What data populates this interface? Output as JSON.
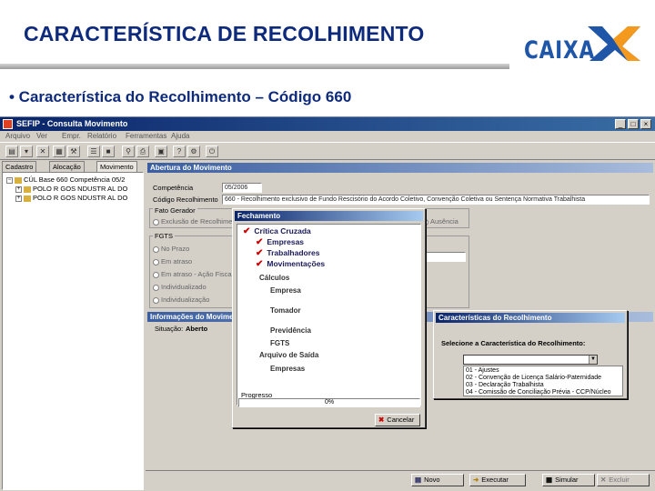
{
  "slide": {
    "title": "CARACTERÍSTICA DE RECOLHIMENTO",
    "bullet": "• Característica do Recolhimento – Código 660",
    "logo_text": "CAIXA",
    "brand_blue": "#1f56a8",
    "brand_orange": "#f39a1e"
  },
  "window": {
    "title": "SEFIP - Consulta Movimento",
    "menu": [
      "Arquivo",
      "Ver",
      "Empr.",
      "Relatório",
      "Ferramentas",
      "Ajuda"
    ],
    "controls": [
      "_",
      "□",
      "×"
    ]
  },
  "left_panel": {
    "tabs": [
      "Cadastro",
      "Alocação",
      "Movimento"
    ],
    "tree": [
      {
        "toggle": "−",
        "label": "CÚL Base 660 Competência 05/2"
      },
      {
        "toggle": "+",
        "label": "POLO R GOS NDUSTR AL DO"
      },
      {
        "toggle": "+",
        "label": "POLO R GOS NDUSTR AL DO"
      }
    ]
  },
  "main": {
    "section1": "Abertura do Movimento",
    "competencia_label": "Competência",
    "competencia_value": "05/2006",
    "codigo_label": "Código Recolhimento",
    "codigo_value": "660 - Recolhimento exclusivo de Fundo Rescisório do Acordo Coletivo, Convenção Coletiva ou Sentença Normativa Trabalhista",
    "fato_gerador_label": "Fato Gerador",
    "fato_gerador_option": "Exclusão de Recolhimento",
    "fato_gerador_option2": "Ausência",
    "fgts_label": "FGTS",
    "fgts_options": [
      "No Prazo",
      "Em atraso",
      "Em atraso - Ação Fiscal",
      "Individualizado",
      "Individualização"
    ],
    "section2": "Informações do Movimento",
    "situacao_label": "Situação:",
    "situacao_value": "Aberto"
  },
  "fechamento": {
    "title": "Fechamento",
    "checked": [
      "Crítica Cruzada",
      "Empresas",
      "Trabalhadores",
      "Movimentações"
    ],
    "calculos_label": "Cálculos",
    "calculos_items": [
      "Empresa",
      "Tomador",
      "Previdência",
      "FGTS"
    ],
    "arquivo_label": "Arquivo de Saída",
    "arquivo_items": [
      "Empresas"
    ],
    "progress_label": "Progresso",
    "progress_value": "0%",
    "progress_fraction": 0,
    "cancel_label": "Cancelar"
  },
  "caracteristicas": {
    "title": "Características do Recolhimento",
    "prompt": "Selecione a Característica do Recolhimento:",
    "options": [
      "01 - Ajustes",
      "02 - Convenção de Licença Salário-Paternidade",
      "03 - Declaração Trabalhista",
      "04 - Comissão de Conciliação Prévia - CCP/Núcleo"
    ]
  },
  "bottom_buttons": [
    "Novo",
    "Executar",
    "Simular",
    "Excluir"
  ]
}
